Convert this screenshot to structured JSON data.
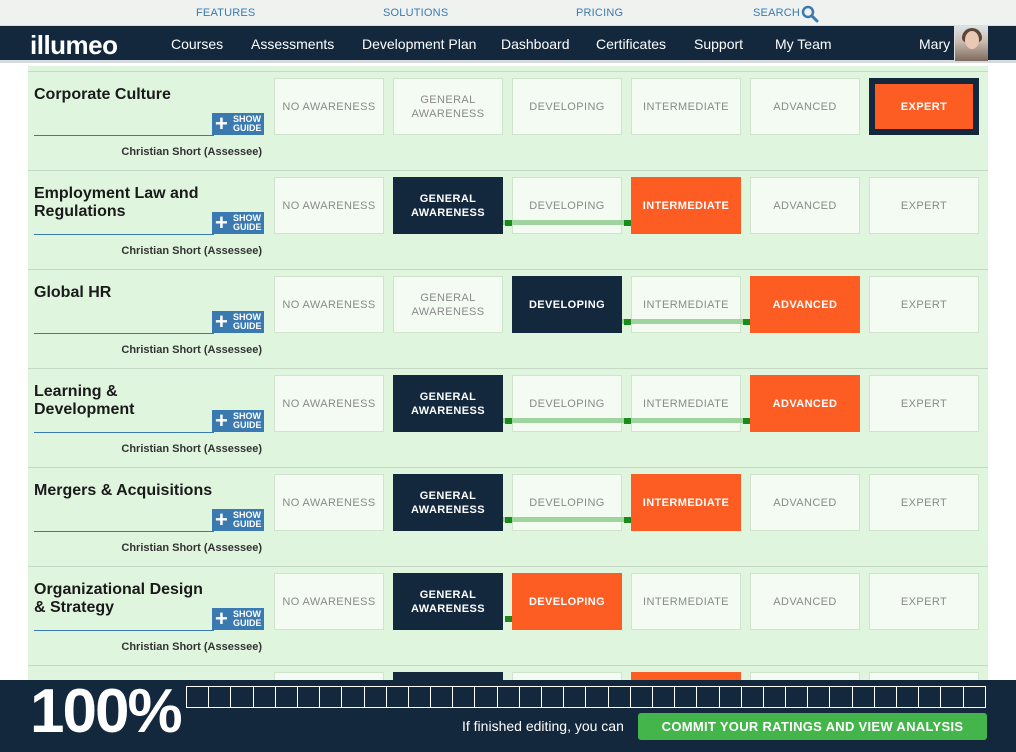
{
  "toplinks": [
    "FEATURES",
    "SOLUTIONS",
    "PRICING",
    "SEARCH"
  ],
  "brand": "illumeo",
  "nav": [
    "Courses",
    "Assessments",
    "Development Plan",
    "Dashboard",
    "Certificates",
    "Support",
    "My Team"
  ],
  "user": "Mary",
  "levels": [
    "NO AWARENESS",
    "GENERAL AWARENESS",
    "DEVELOPING",
    "INTERMEDIATE",
    "ADVANCED",
    "EXPERT"
  ],
  "guide_plus": "+",
  "guide_label_1": "SHOW",
  "guide_label_2": "GUIDE",
  "skills": [
    {
      "title": "Corporate Culture",
      "assessee": "Christian Short (Assessee)",
      "current": 5,
      "target": 5
    },
    {
      "title": "Employment Law and Regulations",
      "assessee": "Christian Short (Assessee)",
      "current": 1,
      "target": 3
    },
    {
      "title": "Global HR",
      "assessee": "Christian Short (Assessee)",
      "current": 2,
      "target": 4
    },
    {
      "title": "Learning & Development",
      "assessee": "Christian Short (Assessee)",
      "current": 1,
      "target": 4
    },
    {
      "title": "Mergers & Acquisitions",
      "assessee": "Christian Short (Assessee)",
      "current": 1,
      "target": 3
    },
    {
      "title": "Organizational Design & Strategy",
      "assessee": "Christian Short (Assessee)",
      "current": 1,
      "target": 2
    },
    {
      "title": "",
      "assessee": "",
      "current": 1,
      "target": 3
    }
  ],
  "footer": {
    "percent": "100%",
    "progress": 0,
    "finish_text": "If finished editing, you can",
    "commit_label": "COMMIT YOUR RATINGS AND VIEW ANALYSIS"
  },
  "colors": {
    "navy": "#13273d",
    "orange": "#fd5c23",
    "green": "#43b54a",
    "light_green": "#dff5de"
  }
}
